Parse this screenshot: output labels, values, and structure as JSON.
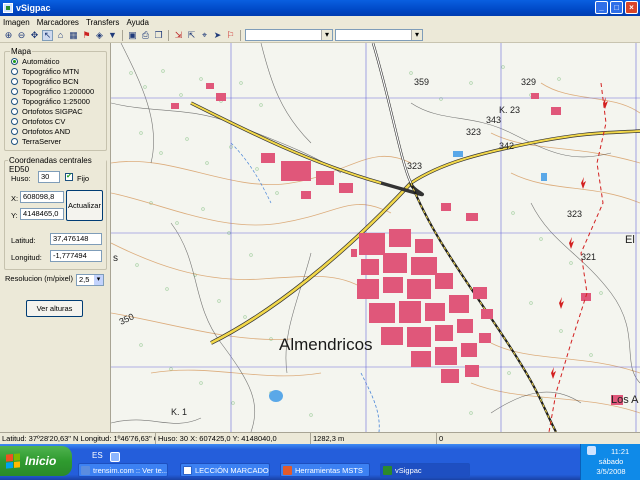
{
  "window": {
    "title": "vSigpac",
    "minimize": "_",
    "maximize": "□",
    "close": "×"
  },
  "menu": [
    "Imagen",
    "Marcadores",
    "Transfers",
    "Ayuda"
  ],
  "toolbar": {
    "icons": [
      "zoom-in-icon",
      "zoom-out-icon",
      "pan-icon",
      "select-arrow-icon",
      "home-icon",
      "grid-icon",
      "marker-icon",
      "layers-icon",
      "flag-icon",
      "save-icon",
      "print-icon",
      "copy-icon",
      "paste-icon",
      "import-icon",
      "export-icon",
      "gps-icon",
      "gps-send-icon",
      "info-icon"
    ],
    "combo1_value": "",
    "combo2_value": ""
  },
  "panel": {
    "mapa_legend": "Mapa",
    "map_options": [
      "Automático",
      "Topográfico MTN",
      "Topográfico BCN",
      "Topográfico 1:200000",
      "Topográfico 1:25000",
      "Ortofotos SIGPAC",
      "Ortofotos CV",
      "Ortofotos AND",
      "TerraServer"
    ],
    "selected_map": "Automático",
    "coords_legend": "Coordenadas centrales ED50",
    "huso_label": "Huso:",
    "huso_value": "30",
    "fijo_label": "Fijo",
    "fijo_checked": true,
    "x_label": "X:",
    "x_value": "608098,8",
    "y_label": "Y:",
    "y_value": "4148465,0",
    "actualizar_label": "Actualizar",
    "latitud_label": "Latitud:",
    "latitud_value": "37,476148",
    "longitud_label": "Longitud:",
    "longitud_value": "-1,777494",
    "resolucion_label": "Resolucion (m/pixel)",
    "resolucion_value": "2,5",
    "ver_alturas_label": "Ver alturas"
  },
  "map": {
    "town_label": "Almendricos",
    "elevations": [
      "359",
      "329",
      "323",
      "343",
      "342",
      "323",
      "323",
      "321",
      "350"
    ],
    "place_labels": [
      "K. 23",
      "K. 1",
      "El",
      "Los A",
      "s"
    ],
    "colors": {
      "buildings": "#e0577a",
      "road": "#f2d84a",
      "rail": "#1d1d1d",
      "contour": "#d89a5c",
      "grid": "#6a6ad8",
      "water": "#5aa8e8"
    }
  },
  "status": {
    "latlon": "Latitud: 37º28'20,63\" N Longitud: 1º46'76,63\" O",
    "utm": "Huso: 30 X: 607425,0 Y: 4148040,0",
    "elevation": "1282,3 m",
    "extra": "0"
  },
  "taskbar": {
    "start_label": "Inicio",
    "language": "ES",
    "tasks": [
      {
        "label": "trensim.com :: Ver te...",
        "color": "#3a7fd8"
      },
      {
        "label": "LECCIÓN MARCADO...",
        "color": "#2c62c9"
      },
      {
        "label": "Herramientas MSTS",
        "color": "#e35a2a"
      },
      {
        "label": "vSigpac",
        "color": "#2c8a2c"
      }
    ],
    "active_task": "vSigpac",
    "time": "11:21",
    "day": "sábado",
    "date": "3/5/2008"
  }
}
